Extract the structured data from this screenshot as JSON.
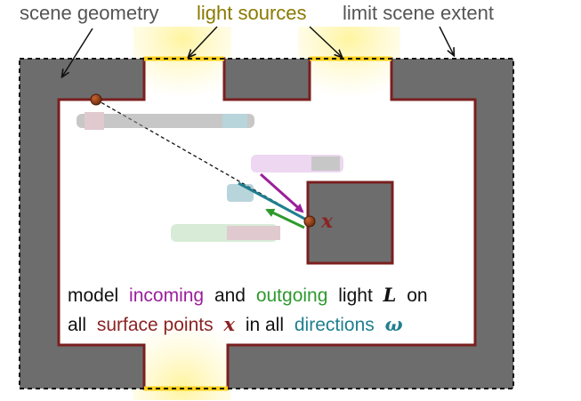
{
  "top_labels": {
    "scene_geometry": "scene geometry",
    "light_sources": "light sources",
    "limit_scene_extent": "limit scene extent"
  },
  "math": {
    "x": "x",
    "L": "L",
    "omega": "ω"
  },
  "caption": {
    "line1": {
      "w1": "model",
      "w2": "incoming",
      "w3": "and",
      "w4": "outgoing",
      "w5": "light",
      "w6": "on"
    },
    "line2": {
      "w1": "all",
      "w2": "surface points",
      "w3": "in all",
      "w4": "directions"
    }
  },
  "colors": {
    "wall": "#6d6d6d",
    "outline": "#7a1f1f",
    "light": "#ffd21a",
    "label_dark": "#555555",
    "label_light": "#8a7a00",
    "incoming": "#9b1f9b",
    "outgoing": "#2e9a2e",
    "direction": "#1f7f8f",
    "surface": "#8b2323"
  }
}
